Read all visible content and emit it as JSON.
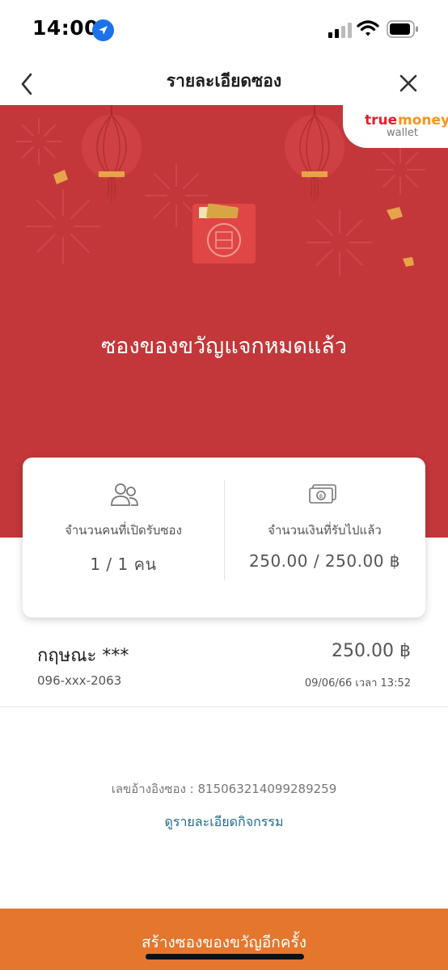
{
  "status_bar": {
    "time": "14:00"
  },
  "nav": {
    "title": "รายละเอียดซอง"
  },
  "brand": {
    "part1": "true",
    "part2": "money",
    "sub": "wallet"
  },
  "hero": {
    "title": "ซองของขวัญแจกหมดแล้ว"
  },
  "summary": {
    "people_label": "จำนวนคนที่เปิดรับซอง",
    "people_value": "1 / 1 คน",
    "amount_label": "จำนวนเงินที่รับไปแล้ว",
    "amount_value": "250.00 / 250.00 ฿"
  },
  "recipient": {
    "name": "กฤษณะ ***",
    "amount": "250.00 ฿",
    "phone": "096-xxx-2063",
    "time": "09/06/66 เวลา 13:52"
  },
  "reference": "เลขอ้างอิงซอง : 815063214099289259",
  "detail_link": "ดูรายละเอียดกิจกรรม",
  "create_button": "สร้างซองของขวัญอีกครั้ง",
  "colors": {
    "hero": "#c3373a",
    "button": "#e4762d",
    "link": "#1f6a8a",
    "location": "#1a73e8"
  }
}
